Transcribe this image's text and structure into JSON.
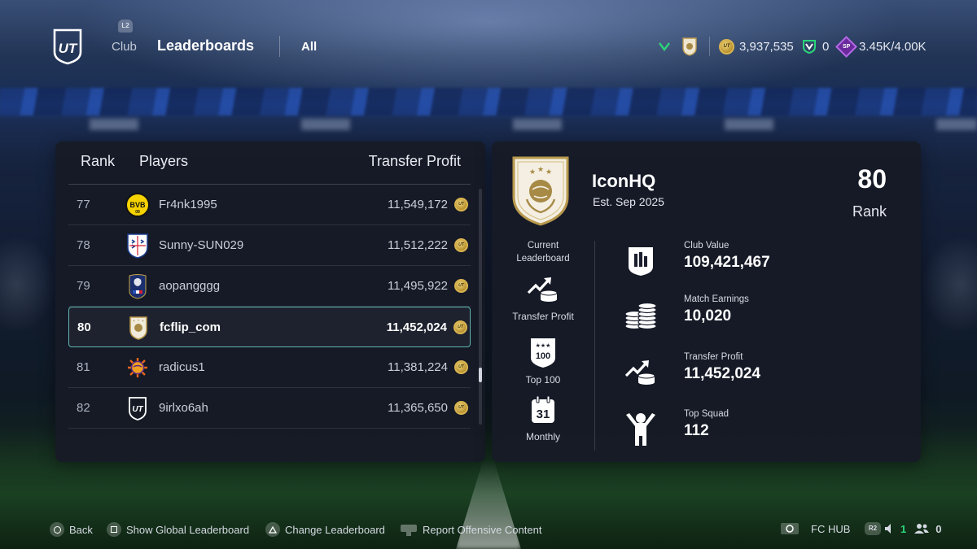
{
  "topbar": {
    "l2_label": "L2",
    "nav_club": "Club",
    "nav_title": "Leaderboards",
    "nav_filter": "All",
    "coins": "3,937,535",
    "points": "0",
    "sp_label": "SP",
    "sp_value": "3.45K/4.00K",
    "coin_mark": "UT"
  },
  "leaderboard": {
    "headers": {
      "rank": "Rank",
      "players": "Players",
      "profit": "Transfer Profit"
    },
    "rows": [
      {
        "rank": "77",
        "name": "Fr4nk1995",
        "profit": "11,549,172",
        "crest": "bvb-crest",
        "active": false
      },
      {
        "rank": "78",
        "name": "Sunny-SUN029",
        "profit": "11,512,222",
        "crest": "england-crest",
        "active": false
      },
      {
        "rank": "79",
        "name": "aopangggg",
        "profit": "11,495,922",
        "crest": "france-crest",
        "active": false
      },
      {
        "rank": "80",
        "name": "fcflip_com",
        "profit": "11,452,024",
        "crest": "icon-crest",
        "active": true
      },
      {
        "rank": "81",
        "name": "radicus1",
        "profit": "11,381,224",
        "crest": "suns-crest",
        "active": false
      },
      {
        "rank": "82",
        "name": "9irlxo6ah",
        "profit": "11,365,650",
        "crest": "ut-crest",
        "active": false
      }
    ]
  },
  "club": {
    "name": "IconHQ",
    "established": "Est. Sep 2025",
    "rank_value": "80",
    "rank_label": "Rank",
    "current_leaderboard_label": "Current\nLeaderboard",
    "leaderboard_types": [
      {
        "label": "Transfer Profit",
        "icon": "transfer-profit-icon"
      },
      {
        "label": "Top 100",
        "icon": "top-100-icon",
        "badge": "100"
      },
      {
        "label": "Monthly",
        "icon": "calendar-icon",
        "badge": "31"
      }
    ],
    "stats": [
      {
        "label": "Club Value",
        "value": "109,421,467",
        "icon": "club-value-icon"
      },
      {
        "label": "Match Earnings",
        "value": "10,020",
        "icon": "coins-stack-icon"
      },
      {
        "label": "Transfer Profit",
        "value": "11,452,024",
        "icon": "transfer-profit-icon"
      },
      {
        "label": "Top Squad",
        "value": "112",
        "icon": "top-squad-icon"
      }
    ]
  },
  "bottombar": {
    "back": "Back",
    "global": "Show Global Leaderboard",
    "change": "Change Leaderboard",
    "report": "Report Offensive Content",
    "fchub": "FC HUB",
    "r2": "R2",
    "party_count": "1",
    "friends_count": "0"
  },
  "colors": {
    "accent_teal": "#5fb7b0",
    "coin_gold": "#d9b44f",
    "sp_purple": "#6a2a9c",
    "points_green": "#2bd47a"
  }
}
